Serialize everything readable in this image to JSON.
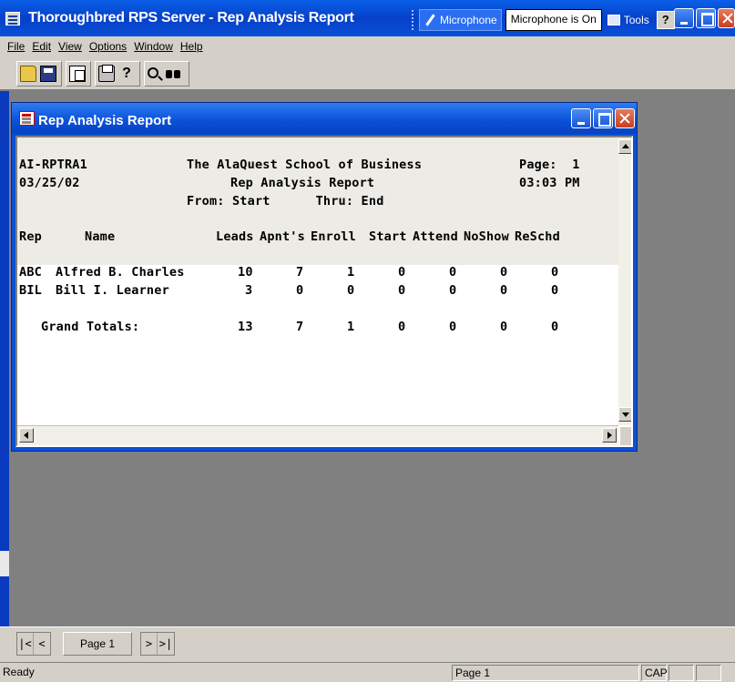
{
  "app": {
    "title": "Thoroughbred RPS Server - Rep Analysis Report"
  },
  "language_bar": {
    "microphone_label": "Microphone",
    "microphone_status": "Microphone is On",
    "tools_label": "Tools",
    "help_label": "?",
    "chevron": ":"
  },
  "menu": {
    "items": [
      "File",
      "Edit",
      "View",
      "Options",
      "Window",
      "Help"
    ]
  },
  "toolbar": {
    "icons": [
      "open-folder-icon",
      "save-disk-icon",
      "copy-icon",
      "print-icon",
      "help-question-icon",
      "zoom-magnifier-icon",
      "find-binoculars-icon"
    ],
    "help_glyph": "?"
  },
  "child_window": {
    "title": "Rep Analysis Report"
  },
  "report": {
    "id": "AI-RPTRA1",
    "date": "03/25/02",
    "school": "The AlaQuest School of Business",
    "report_title": "Rep Analysis Report",
    "range": "From: Start      Thru: End",
    "page_label": "Page:  1",
    "time": "03:03 PM",
    "columns": [
      "Rep",
      "Name",
      "Leads",
      "Apnt's",
      "Enroll",
      "Start",
      "Attend",
      "NoShow",
      "ReSchd"
    ],
    "rows": [
      {
        "rep": "ABC",
        "name": "Alfred B. Charles",
        "values": [
          "10",
          "7",
          "1",
          "0",
          "0",
          "0",
          "0"
        ]
      },
      {
        "rep": "BIL",
        "name": "Bill I. Learner",
        "values": [
          "3",
          "0",
          "0",
          "0",
          "0",
          "0",
          "0"
        ]
      }
    ],
    "totals": {
      "label": "Grand Totals:",
      "values": [
        "13",
        "7",
        "1",
        "0",
        "0",
        "0",
        "0"
      ]
    }
  },
  "navigation": {
    "first": "|<",
    "prev": "<",
    "page": "Page 1",
    "next": ">",
    "last": ">|"
  },
  "status": {
    "ready": "Ready",
    "page": "Page 1",
    "cap": "CAP"
  }
}
